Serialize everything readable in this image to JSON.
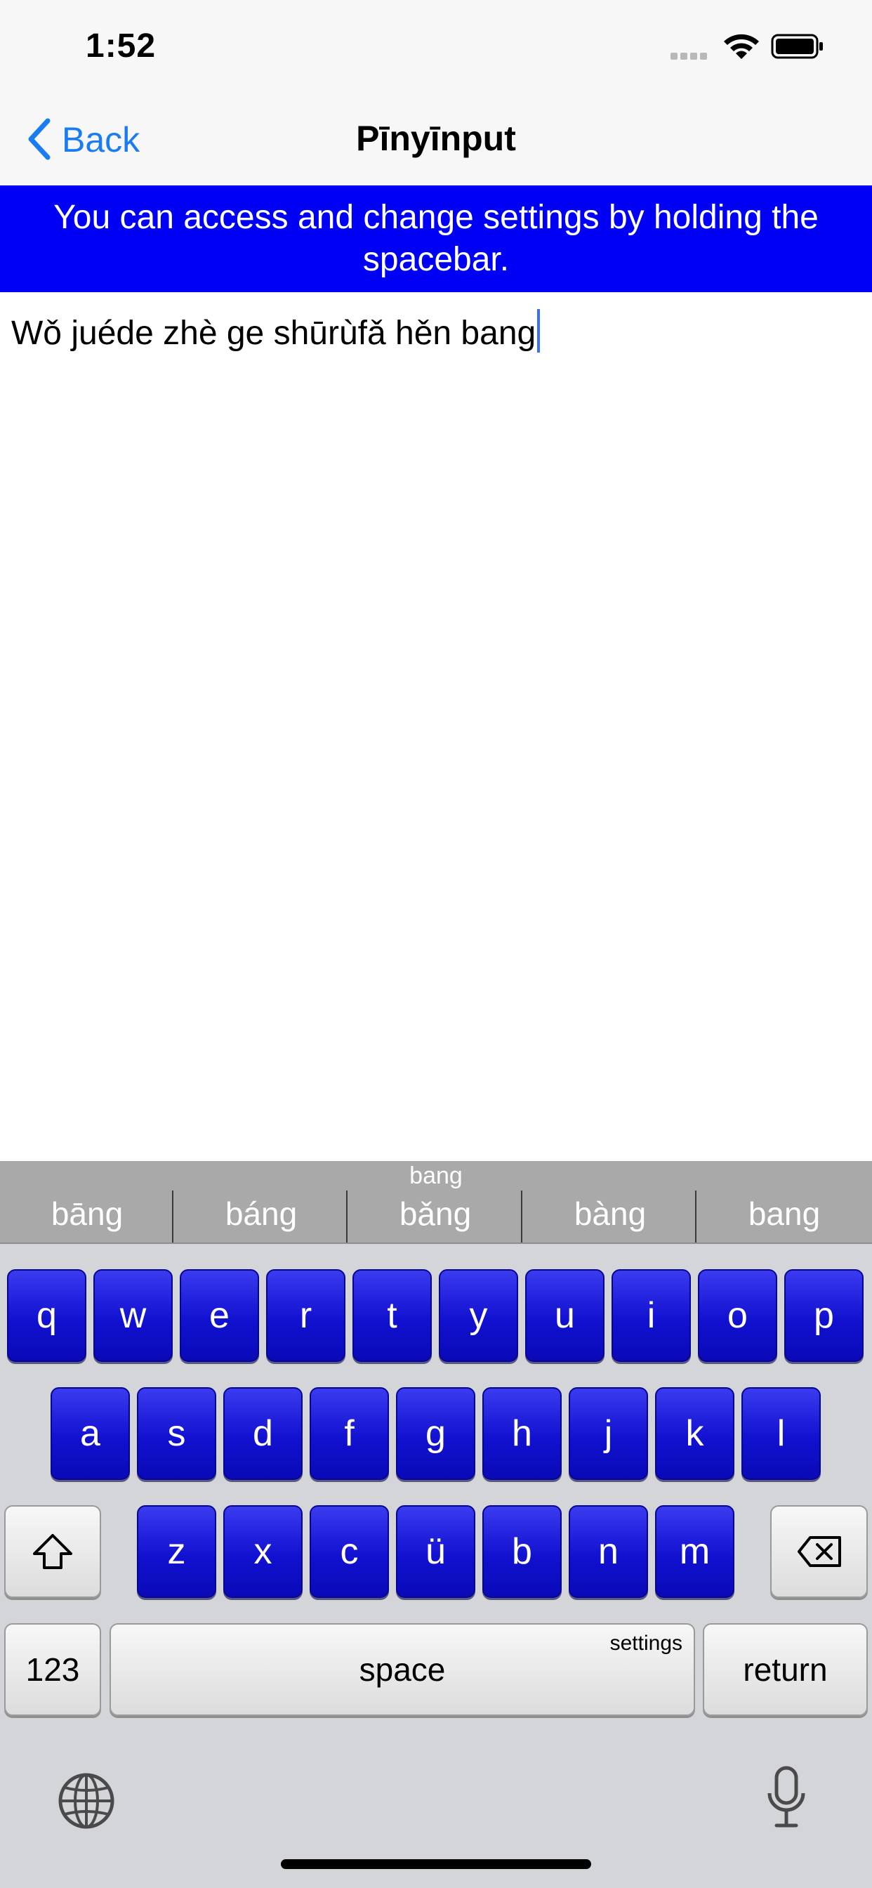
{
  "status_bar": {
    "time": "1:52"
  },
  "nav": {
    "back_label": "Back",
    "title": "Pīnyīnput"
  },
  "banner": {
    "text": "You can access and change settings by holding the spacebar."
  },
  "editor": {
    "text": "Wǒ juéde zhè ge shūrùfǎ hěn bang"
  },
  "suggestions": {
    "above_label": "bang",
    "items": [
      "bāng",
      "báng",
      "bǎng",
      "bàng",
      "bang"
    ]
  },
  "keyboard": {
    "row1": [
      "q",
      "w",
      "e",
      "r",
      "t",
      "y",
      "u",
      "i",
      "o",
      "p"
    ],
    "row2": [
      "a",
      "s",
      "d",
      "f",
      "g",
      "h",
      "j",
      "k",
      "l"
    ],
    "row3": [
      "z",
      "x",
      "c",
      "ü",
      "b",
      "n",
      "m"
    ],
    "numbers_label": "123",
    "space_label": "space",
    "space_hint": "settings",
    "return_label": "return"
  },
  "colors": {
    "accent": "#1a7cf2",
    "banner": "#0000f5",
    "key_blue": "#1111d0",
    "caret": "#3b6ef5"
  },
  "icons": [
    "back-chevron-icon",
    "cellular-icon",
    "wifi-icon",
    "battery-icon",
    "shift-icon",
    "delete-icon",
    "globe-icon",
    "microphone-icon"
  ]
}
